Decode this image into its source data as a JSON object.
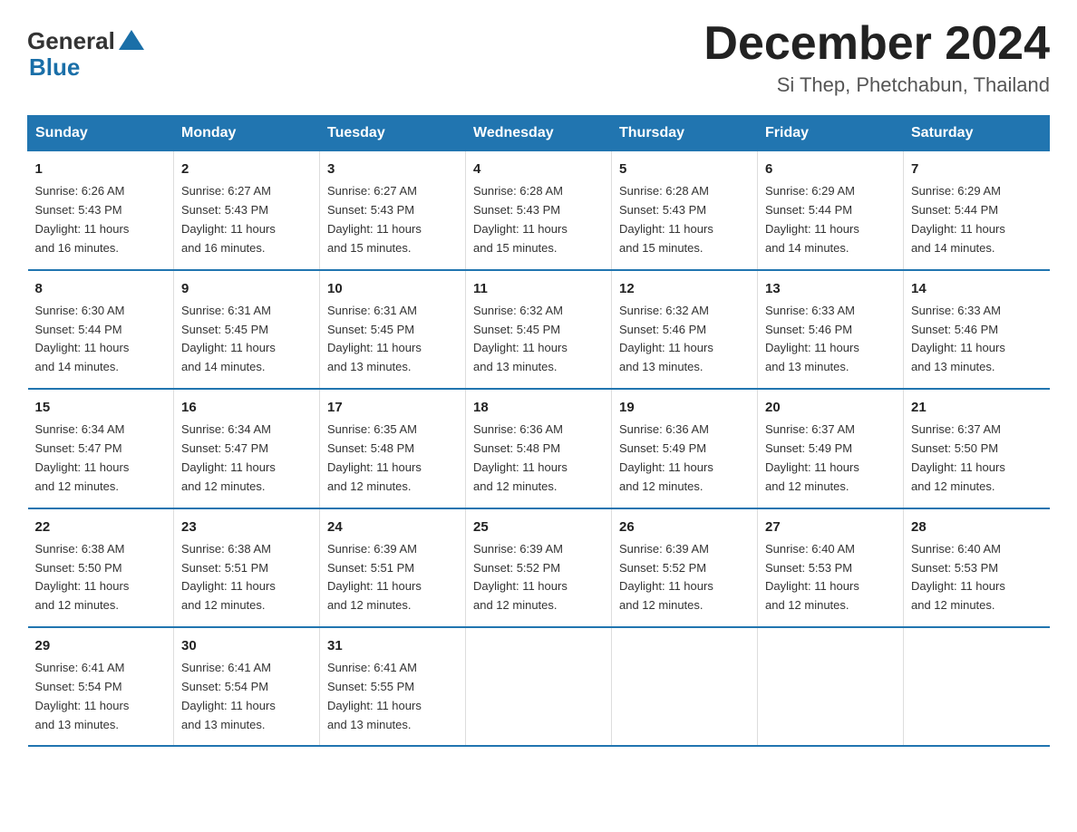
{
  "logo": {
    "general": "General",
    "blue": "Blue"
  },
  "title": "December 2024",
  "subtitle": "Si Thep, Phetchabun, Thailand",
  "days_of_week": [
    "Sunday",
    "Monday",
    "Tuesday",
    "Wednesday",
    "Thursday",
    "Friday",
    "Saturday"
  ],
  "weeks": [
    [
      {
        "day": "1",
        "sunrise": "6:26 AM",
        "sunset": "5:43 PM",
        "daylight": "11 hours and 16 minutes."
      },
      {
        "day": "2",
        "sunrise": "6:27 AM",
        "sunset": "5:43 PM",
        "daylight": "11 hours and 16 minutes."
      },
      {
        "day": "3",
        "sunrise": "6:27 AM",
        "sunset": "5:43 PM",
        "daylight": "11 hours and 15 minutes."
      },
      {
        "day": "4",
        "sunrise": "6:28 AM",
        "sunset": "5:43 PM",
        "daylight": "11 hours and 15 minutes."
      },
      {
        "day": "5",
        "sunrise": "6:28 AM",
        "sunset": "5:43 PM",
        "daylight": "11 hours and 15 minutes."
      },
      {
        "day": "6",
        "sunrise": "6:29 AM",
        "sunset": "5:44 PM",
        "daylight": "11 hours and 14 minutes."
      },
      {
        "day": "7",
        "sunrise": "6:29 AM",
        "sunset": "5:44 PM",
        "daylight": "11 hours and 14 minutes."
      }
    ],
    [
      {
        "day": "8",
        "sunrise": "6:30 AM",
        "sunset": "5:44 PM",
        "daylight": "11 hours and 14 minutes."
      },
      {
        "day": "9",
        "sunrise": "6:31 AM",
        "sunset": "5:45 PM",
        "daylight": "11 hours and 14 minutes."
      },
      {
        "day": "10",
        "sunrise": "6:31 AM",
        "sunset": "5:45 PM",
        "daylight": "11 hours and 13 minutes."
      },
      {
        "day": "11",
        "sunrise": "6:32 AM",
        "sunset": "5:45 PM",
        "daylight": "11 hours and 13 minutes."
      },
      {
        "day": "12",
        "sunrise": "6:32 AM",
        "sunset": "5:46 PM",
        "daylight": "11 hours and 13 minutes."
      },
      {
        "day": "13",
        "sunrise": "6:33 AM",
        "sunset": "5:46 PM",
        "daylight": "11 hours and 13 minutes."
      },
      {
        "day": "14",
        "sunrise": "6:33 AM",
        "sunset": "5:46 PM",
        "daylight": "11 hours and 13 minutes."
      }
    ],
    [
      {
        "day": "15",
        "sunrise": "6:34 AM",
        "sunset": "5:47 PM",
        "daylight": "11 hours and 12 minutes."
      },
      {
        "day": "16",
        "sunrise": "6:34 AM",
        "sunset": "5:47 PM",
        "daylight": "11 hours and 12 minutes."
      },
      {
        "day": "17",
        "sunrise": "6:35 AM",
        "sunset": "5:48 PM",
        "daylight": "11 hours and 12 minutes."
      },
      {
        "day": "18",
        "sunrise": "6:36 AM",
        "sunset": "5:48 PM",
        "daylight": "11 hours and 12 minutes."
      },
      {
        "day": "19",
        "sunrise": "6:36 AM",
        "sunset": "5:49 PM",
        "daylight": "11 hours and 12 minutes."
      },
      {
        "day": "20",
        "sunrise": "6:37 AM",
        "sunset": "5:49 PM",
        "daylight": "11 hours and 12 minutes."
      },
      {
        "day": "21",
        "sunrise": "6:37 AM",
        "sunset": "5:50 PM",
        "daylight": "11 hours and 12 minutes."
      }
    ],
    [
      {
        "day": "22",
        "sunrise": "6:38 AM",
        "sunset": "5:50 PM",
        "daylight": "11 hours and 12 minutes."
      },
      {
        "day": "23",
        "sunrise": "6:38 AM",
        "sunset": "5:51 PM",
        "daylight": "11 hours and 12 minutes."
      },
      {
        "day": "24",
        "sunrise": "6:39 AM",
        "sunset": "5:51 PM",
        "daylight": "11 hours and 12 minutes."
      },
      {
        "day": "25",
        "sunrise": "6:39 AM",
        "sunset": "5:52 PM",
        "daylight": "11 hours and 12 minutes."
      },
      {
        "day": "26",
        "sunrise": "6:39 AM",
        "sunset": "5:52 PM",
        "daylight": "11 hours and 12 minutes."
      },
      {
        "day": "27",
        "sunrise": "6:40 AM",
        "sunset": "5:53 PM",
        "daylight": "11 hours and 12 minutes."
      },
      {
        "day": "28",
        "sunrise": "6:40 AM",
        "sunset": "5:53 PM",
        "daylight": "11 hours and 12 minutes."
      }
    ],
    [
      {
        "day": "29",
        "sunrise": "6:41 AM",
        "sunset": "5:54 PM",
        "daylight": "11 hours and 13 minutes."
      },
      {
        "day": "30",
        "sunrise": "6:41 AM",
        "sunset": "5:54 PM",
        "daylight": "11 hours and 13 minutes."
      },
      {
        "day": "31",
        "sunrise": "6:41 AM",
        "sunset": "5:55 PM",
        "daylight": "11 hours and 13 minutes."
      },
      null,
      null,
      null,
      null
    ]
  ],
  "labels": {
    "sunrise": "Sunrise:",
    "sunset": "Sunset:",
    "daylight": "Daylight:"
  }
}
